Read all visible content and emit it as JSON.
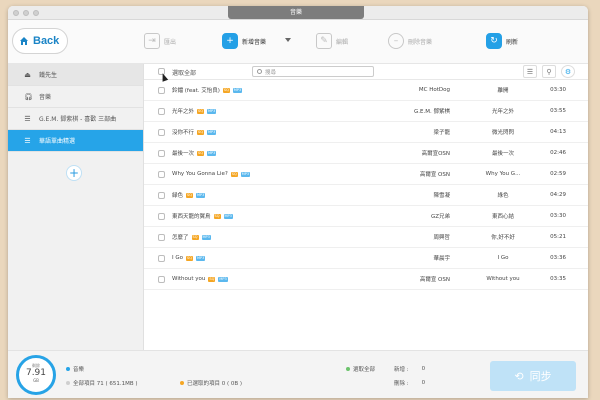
{
  "window": {
    "title": "音樂"
  },
  "toolbar": {
    "back_label": "Back",
    "items": [
      {
        "label": "匯出",
        "icon": "export-icon"
      },
      {
        "label": "新增音樂",
        "icon": "add-music-icon"
      },
      {
        "label": "編輯",
        "icon": "edit-icon"
      },
      {
        "label": "刪除音樂",
        "icon": "delete-icon"
      },
      {
        "label": "刷新",
        "icon": "refresh-icon"
      }
    ]
  },
  "sidebar": {
    "header": "鐵先生",
    "items": [
      {
        "label": "音樂",
        "icon": "headphones-icon"
      },
      {
        "label": "G.E.M. 鄧紫棋 - 喜歡 三部曲",
        "icon": "playlist-icon"
      },
      {
        "label": "華語單曲精選",
        "icon": "playlist-icon",
        "selected": true
      }
    ],
    "add_label": "+"
  },
  "list": {
    "select_all_label": "選取全部",
    "search_placeholder": "搜尋",
    "badges": {
      "sq": "SQ",
      "mp3": "MP3"
    },
    "songs": [
      {
        "title": "鈴鐺 (feat. 艾怡良)",
        "artist": "MC HotDog",
        "album": "離開",
        "time": "03:30"
      },
      {
        "title": "光年之外",
        "artist": "G.E.M. 鄧紫棋",
        "album": "光年之外",
        "time": "03:55"
      },
      {
        "title": "沒你不行",
        "artist": "梁子龍",
        "album": "微光閃閃",
        "time": "04:13"
      },
      {
        "title": "最後一次",
        "artist": "高爾宣OSN",
        "album": "最後一次",
        "time": "02:46"
      },
      {
        "title": "Why You Gonna Lie?",
        "artist": "高爾宣 OSN",
        "album": "Why You G...",
        "time": "02:59"
      },
      {
        "title": "緑色",
        "artist": "陳雪凝",
        "album": "綠色",
        "time": "04:29"
      },
      {
        "title": "東西天龍的翼鳥",
        "artist": "GZ兄弟",
        "album": "東西心結",
        "time": "03:30"
      },
      {
        "title": "怎麼了",
        "artist": "周興哲",
        "album": "你,好不好",
        "time": "05:21"
      },
      {
        "title": "I Go",
        "artist": "華晨宇",
        "album": "I Go",
        "time": "03:36"
      },
      {
        "title": "Without you",
        "artist": "高爾宣 OSN",
        "album": "Without you",
        "time": "03:35"
      }
    ]
  },
  "bottom": {
    "storage_label": "剩餘",
    "storage_value": "7.91",
    "storage_unit": "GB",
    "legend_music": "音樂",
    "legend_all": "全部項目 71 ( 651.1MB )",
    "legend_selected": "已選取的項目 0 ( 0B )",
    "legend_select_all": "選取全部",
    "added_label": "新增 :",
    "added_value": "0",
    "deleted_label": "刪除 :",
    "deleted_value": "0",
    "sync_label": "同步"
  },
  "colors": {
    "accent": "#26a4e8",
    "badge_sq": "#f5a623",
    "badge_mp3": "#5bb8ee",
    "background": "#ead7bd"
  }
}
